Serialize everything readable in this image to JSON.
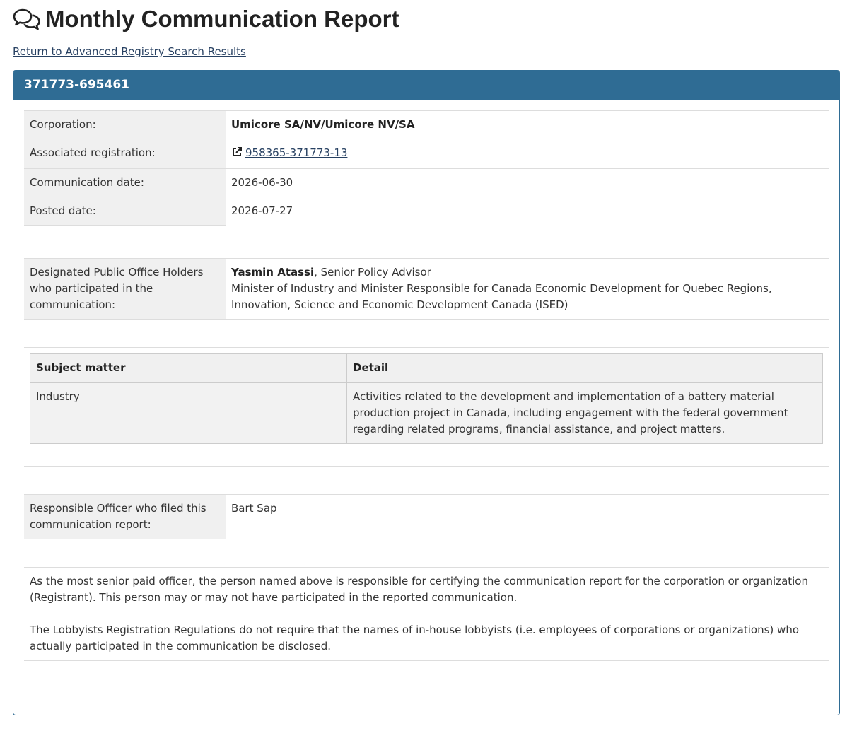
{
  "page": {
    "title": "Monthly Communication Report",
    "back_link": "Return to Advanced Registry Search Results"
  },
  "panel": {
    "heading": "371773-695461"
  },
  "details": {
    "corporation_label": "Corporation:",
    "corporation_value": "Umicore SA/NV/Umicore NV/SA",
    "associated_label": "Associated registration:",
    "associated_value": "958365-371773-13",
    "communication_date_label": "Communication date:",
    "communication_date_value": "2026-06-30",
    "posted_date_label": "Posted date:",
    "posted_date_value": "2026-07-27"
  },
  "dpoh": {
    "label": "Designated Public Office Holders who participated in the communication:",
    "name": "Yasmin Atassi",
    "role": ", Senior Policy Advisor",
    "office": "Minister of Industry and Minister Responsible for Canada Economic Development for Quebec Regions, Innovation, Science and Economic Development Canada (ISED)"
  },
  "subjects": {
    "header_subject": "Subject matter",
    "header_detail": "Detail",
    "rows": [
      {
        "subject": "Industry",
        "detail": "Activities related to the development and implementation of a battery material production project in Canada, including engagement with the federal government regarding related programs, financial assistance, and project matters."
      }
    ]
  },
  "officer": {
    "label": "Responsible Officer who filed this communication report:",
    "value": "Bart Sap"
  },
  "certification": {
    "paragraph1": "As the most senior paid officer, the person named above is responsible for certifying the communication report for the corporation or organization (Registrant). This person may or may not have participated in the reported communication.",
    "paragraph2": "The Lobbyists Registration Regulations do not require that the names of in-house lobbyists (i.e. employees of corporations or organizations) who actually participated in the communication be disclosed."
  },
  "icons": {
    "title_icon": "comments-icon",
    "link_icon": "external-link-icon"
  },
  "colors": {
    "brand": "#2f6c94",
    "link": "#284162"
  }
}
